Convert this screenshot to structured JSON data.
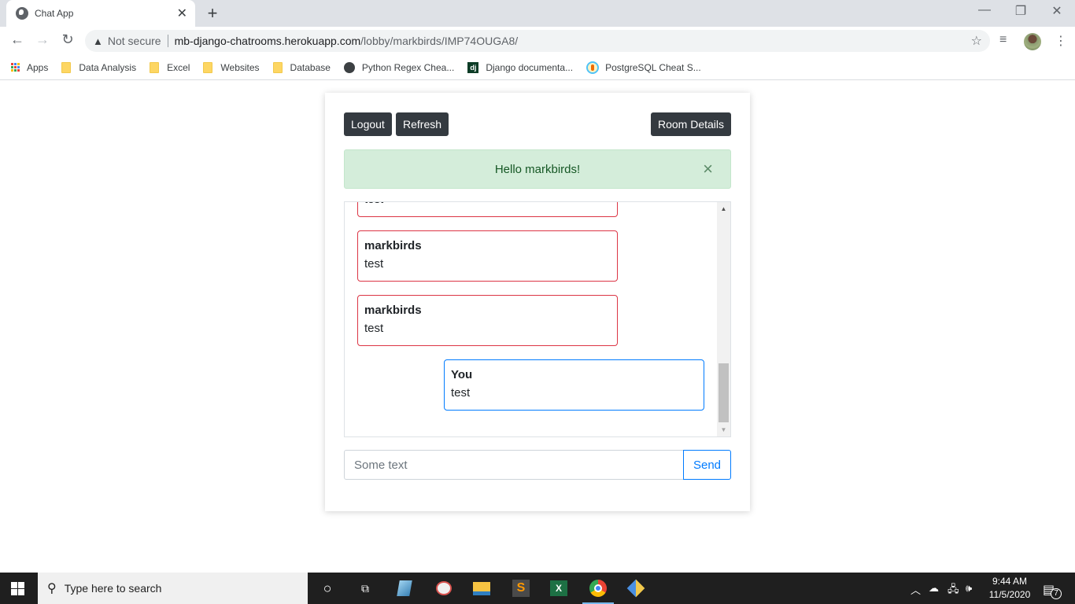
{
  "browser": {
    "tab_title": "Chat App",
    "new_tab_label": "+",
    "security_label": "Not secure",
    "url_host": "mb-django-chatrooms.herokuapp.com",
    "url_path": "/lobby/markbirds/IMP74OUGA8/",
    "bookmarks": [
      {
        "label": "Apps",
        "icon": "apps-grid-icon"
      },
      {
        "label": "Data Analysis",
        "icon": "folder-icon"
      },
      {
        "label": "Excel",
        "icon": "folder-icon"
      },
      {
        "label": "Websites",
        "icon": "folder-icon"
      },
      {
        "label": "Database",
        "icon": "folder-icon"
      },
      {
        "label": "Python Regex Chea...",
        "icon": "python-site-icon"
      },
      {
        "label": "Django documenta...",
        "icon": "django-icon"
      },
      {
        "label": "PostgreSQL Cheat S...",
        "icon": "postgres-site-icon"
      }
    ]
  },
  "page": {
    "buttons": {
      "logout": "Logout",
      "refresh": "Refresh",
      "room_details": "Room Details"
    },
    "alert": {
      "message": "Hello markbirds!",
      "close": "×"
    },
    "messages": [
      {
        "author": "",
        "text": "test",
        "own": false
      },
      {
        "author": "markbirds",
        "text": "test",
        "own": false
      },
      {
        "author": "markbirds",
        "text": "test",
        "own": false
      },
      {
        "author": "You",
        "text": "test",
        "own": true
      }
    ],
    "input": {
      "placeholder": "Some text",
      "value": ""
    },
    "send_label": "Send",
    "colors": {
      "other_border": "#dc3545",
      "own_border": "#007bff",
      "alert_bg": "#d4edda",
      "dark_button": "#343a40"
    }
  },
  "taskbar": {
    "search_placeholder": "Type here to search",
    "time": "9:44 AM",
    "date": "11/5/2020",
    "notification_count": "7"
  }
}
